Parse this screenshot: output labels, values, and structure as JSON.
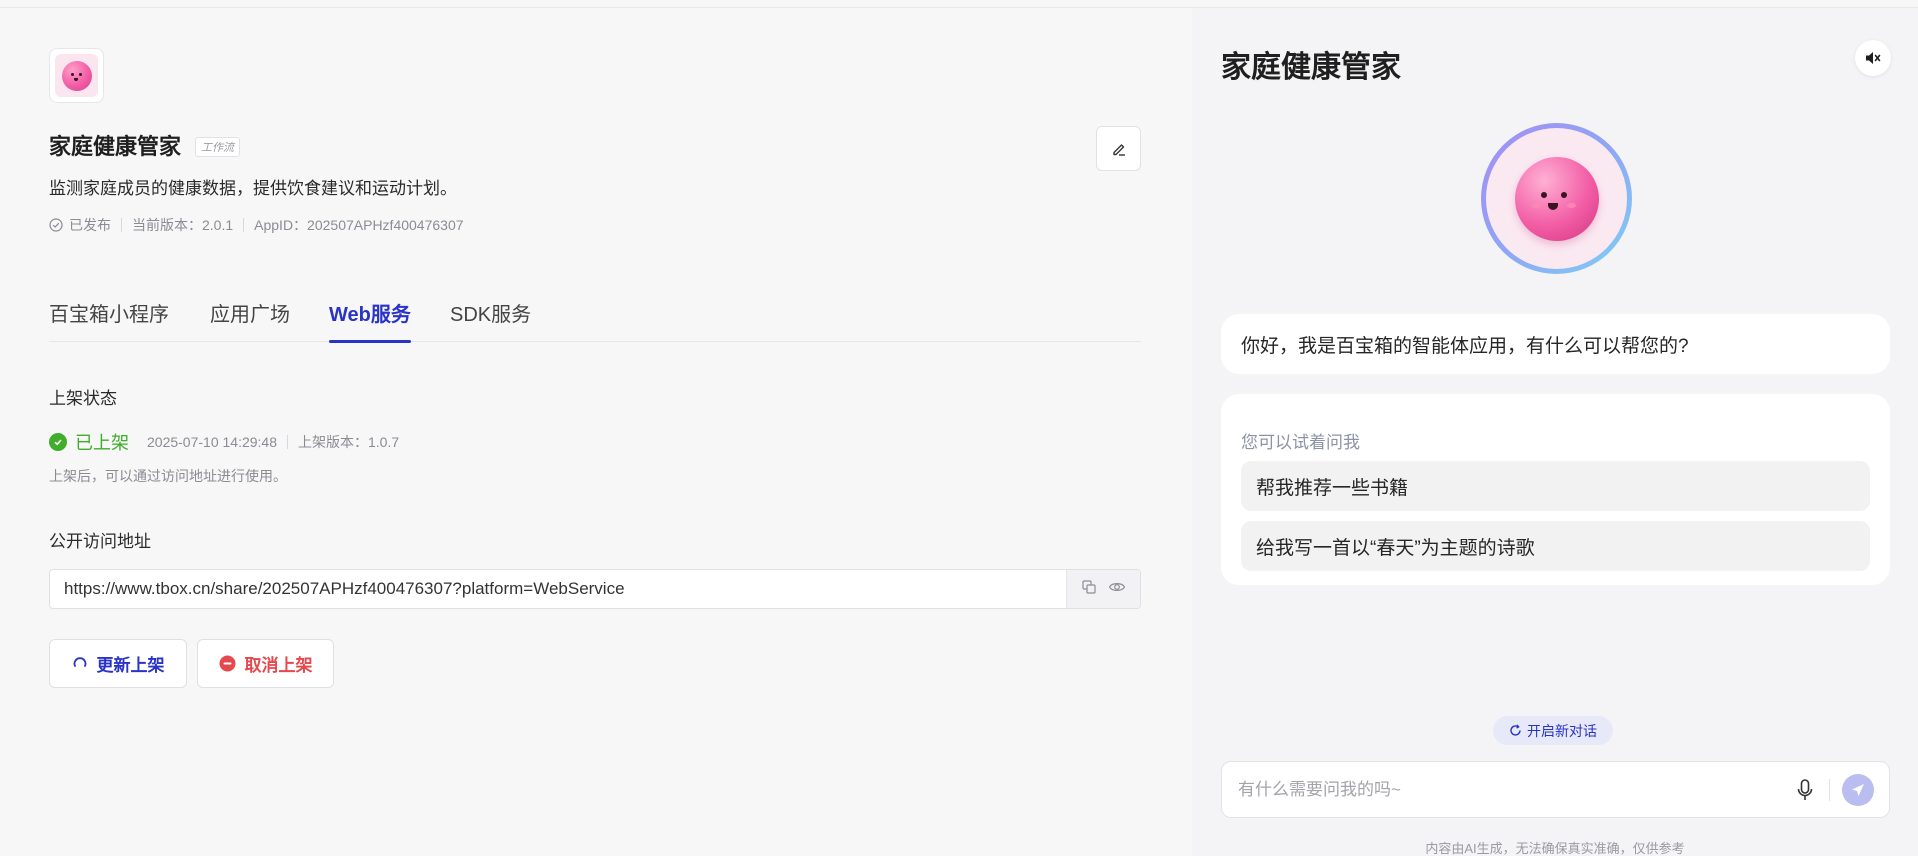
{
  "app": {
    "name": "家庭健康管家",
    "type_tag": "工作流",
    "description": "监测家庭成员的健康数据，提供饮食建议和运动计划。",
    "meta": {
      "status": "已发布",
      "version": "当前版本：2.0.1",
      "app_id": "AppID：202507APHzf400476307"
    }
  },
  "tabs": [
    {
      "label": "百宝箱小程序"
    },
    {
      "label": "应用广场"
    },
    {
      "label": "Web服务",
      "active": true
    },
    {
      "label": "SDK服务"
    }
  ],
  "listing": {
    "label": "上架状态",
    "status": "已上架",
    "timestamp": "2025-07-10 14:29:48",
    "version": "上架版本：1.0.7",
    "hint": "上架后，可以通过访问地址进行使用。"
  },
  "public_url": {
    "label": "公开访问地址",
    "value": "https://www.tbox.cn/share/202507APHzf400476307?platform=WebService"
  },
  "actions": {
    "update_label": "更新上架",
    "cancel_label": "取消上架"
  },
  "chat": {
    "title": "家庭健康管家",
    "greeting": "你好，我是百宝箱的智能体应用，有什么可以帮您的?",
    "suggest_head": "您可以试着问我",
    "suggestions": [
      "帮我推荐一些书籍",
      "给我写一首以“春天”为主题的诗歌"
    ],
    "new_chat_label": "开启新对话",
    "input_placeholder": "有什么需要问我的吗~",
    "disclaimer": "内容由AI生成，无法确保真实准确，仅供参考"
  },
  "colors": {
    "accent": "#2933c7",
    "success": "#3fae2a",
    "danger": "#e5484d"
  },
  "icons": [
    "app-avatar",
    "edit-icon",
    "check-circle-icon",
    "copy-icon",
    "eye-icon",
    "refresh-icon",
    "minus-circle-icon",
    "mute-icon",
    "mic-icon",
    "send-icon"
  ]
}
